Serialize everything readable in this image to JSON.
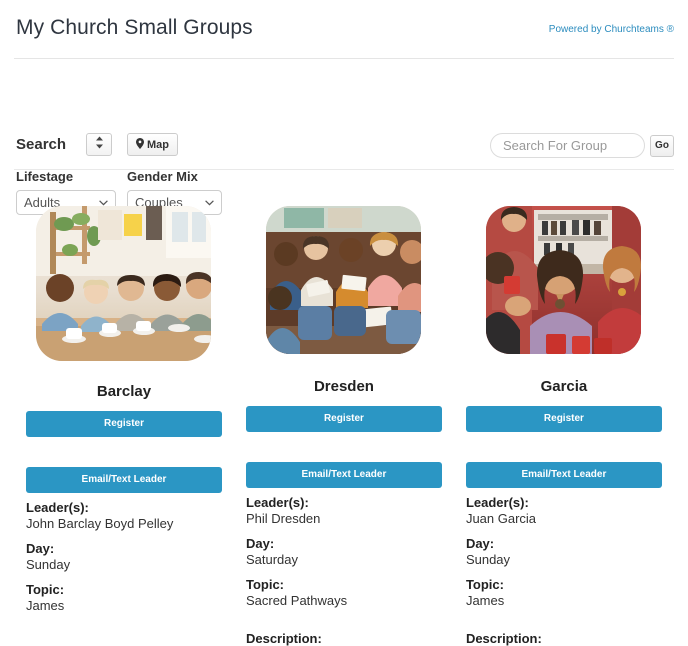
{
  "header": {
    "title": "My Church Small Groups",
    "powered_by": "Powered by Churchteams ®"
  },
  "filters": {
    "search_label": "Search",
    "sort_toggle_icon": "sort-updown-icon",
    "map_button_label": "Map",
    "map_button_icon": "map-pin-icon",
    "lifestage": {
      "label": "Lifestage",
      "value": "Adults",
      "options": [
        "Adults"
      ]
    },
    "gender_mix": {
      "label": "Gender Mix",
      "value": "Couples",
      "options": [
        "Couples"
      ]
    },
    "search_box": {
      "placeholder": "Search For Group",
      "value": "",
      "go_label": "Go"
    }
  },
  "labels": {
    "leaders": "Leader(s):",
    "day": "Day:",
    "topic": "Topic:",
    "description": "Description:",
    "register": "Register",
    "email_text_leader": "Email/Text Leader"
  },
  "groups": [
    {
      "name": "Barclay",
      "photo_alt": "group-photo-cafe-table",
      "leaders": "John Barclay   Boyd Pelley",
      "day": "Sunday",
      "topic": "James",
      "show_description": false
    },
    {
      "name": "Dresden",
      "photo_alt": "group-photo-bible-study-couch",
      "leaders": "Phil Dresden",
      "day": "Saturday",
      "topic": "Sacred Pathways",
      "show_description": true
    },
    {
      "name": "Garcia",
      "photo_alt": "group-photo-social-gathering",
      "leaders": "Juan Garcia",
      "day": "Sunday",
      "topic": "James",
      "show_description": true
    }
  ],
  "colors": {
    "accent_blue": "#2b96c4",
    "link_blue": "#2b8cbe",
    "text_dark": "#333333"
  }
}
